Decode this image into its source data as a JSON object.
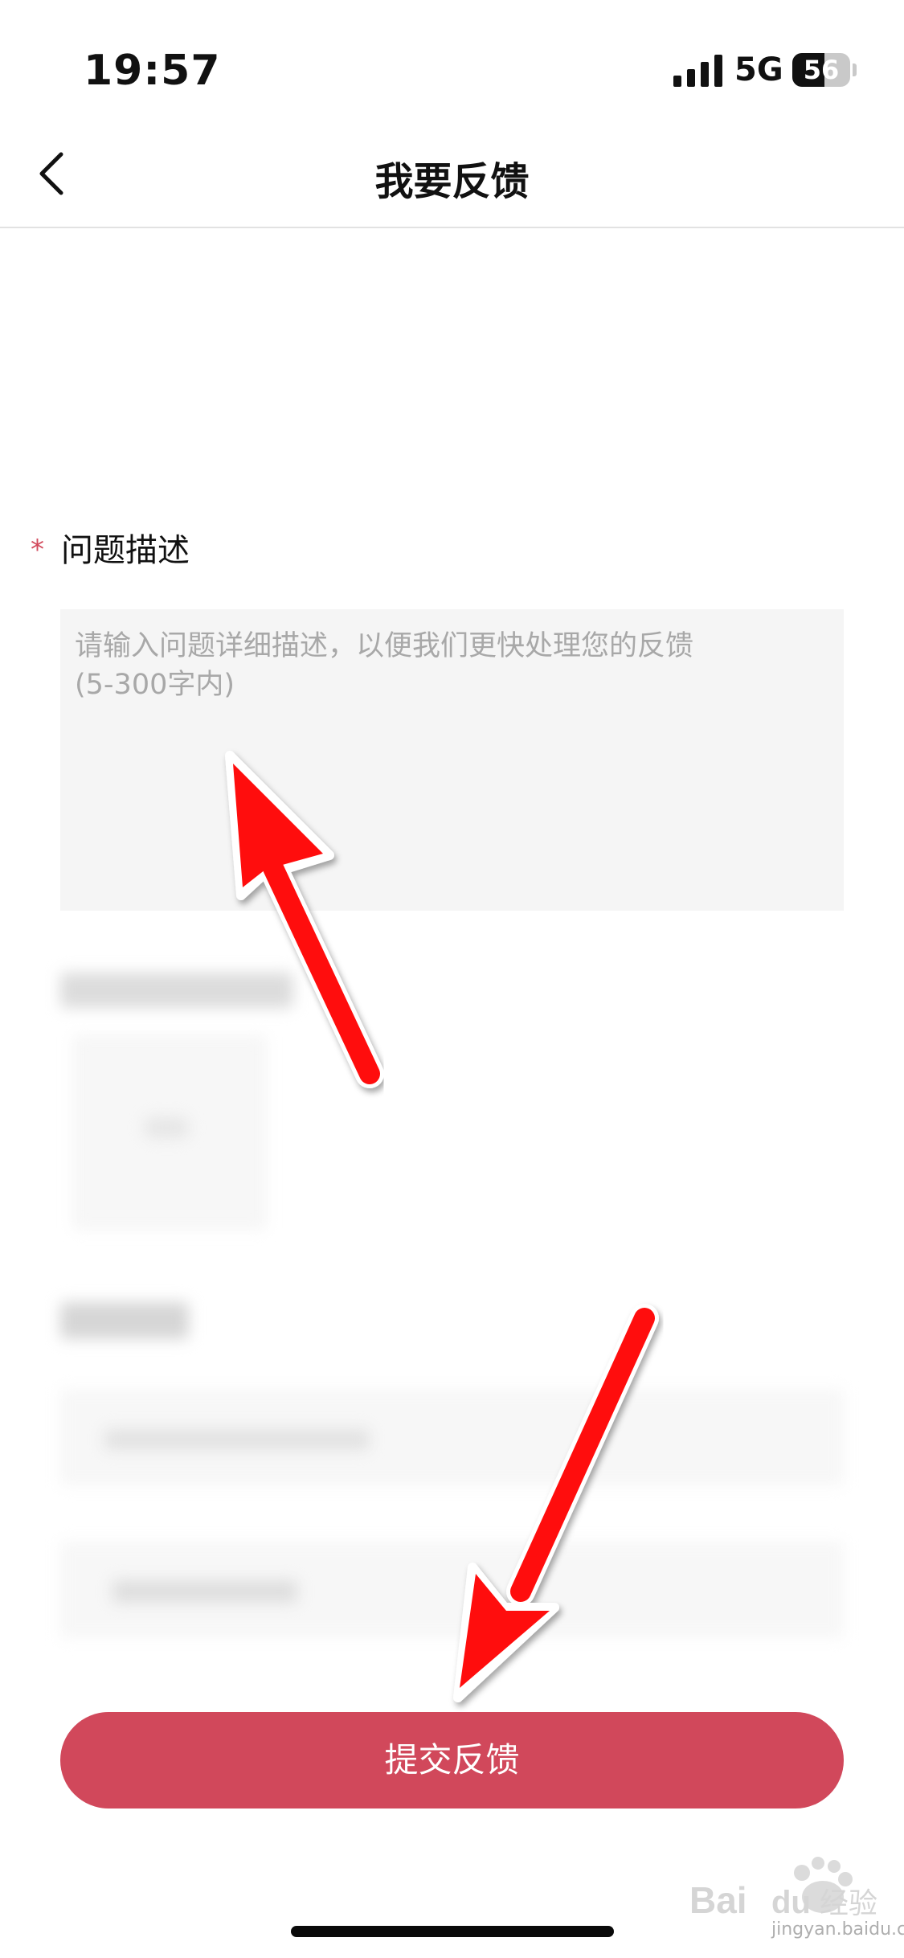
{
  "status_bar": {
    "time": "19:57",
    "network": "5G",
    "battery": "56",
    "battery_level": 0.56
  },
  "nav": {
    "title": "我要反馈",
    "back_icon": "chevron-left-icon"
  },
  "form": {
    "description_label": "问题描述",
    "required_mark": "*",
    "description_placeholder": "请输入问题详细描述，以便我们更快处理您的反馈\n(5-300字内)"
  },
  "submit": {
    "label": "提交反馈",
    "color": "#d1485b"
  },
  "annotations": {
    "arrow_color": "#ff0000"
  },
  "watermark": {
    "brand": "Bai du 经验",
    "url": "jingyan.baidu.com"
  }
}
